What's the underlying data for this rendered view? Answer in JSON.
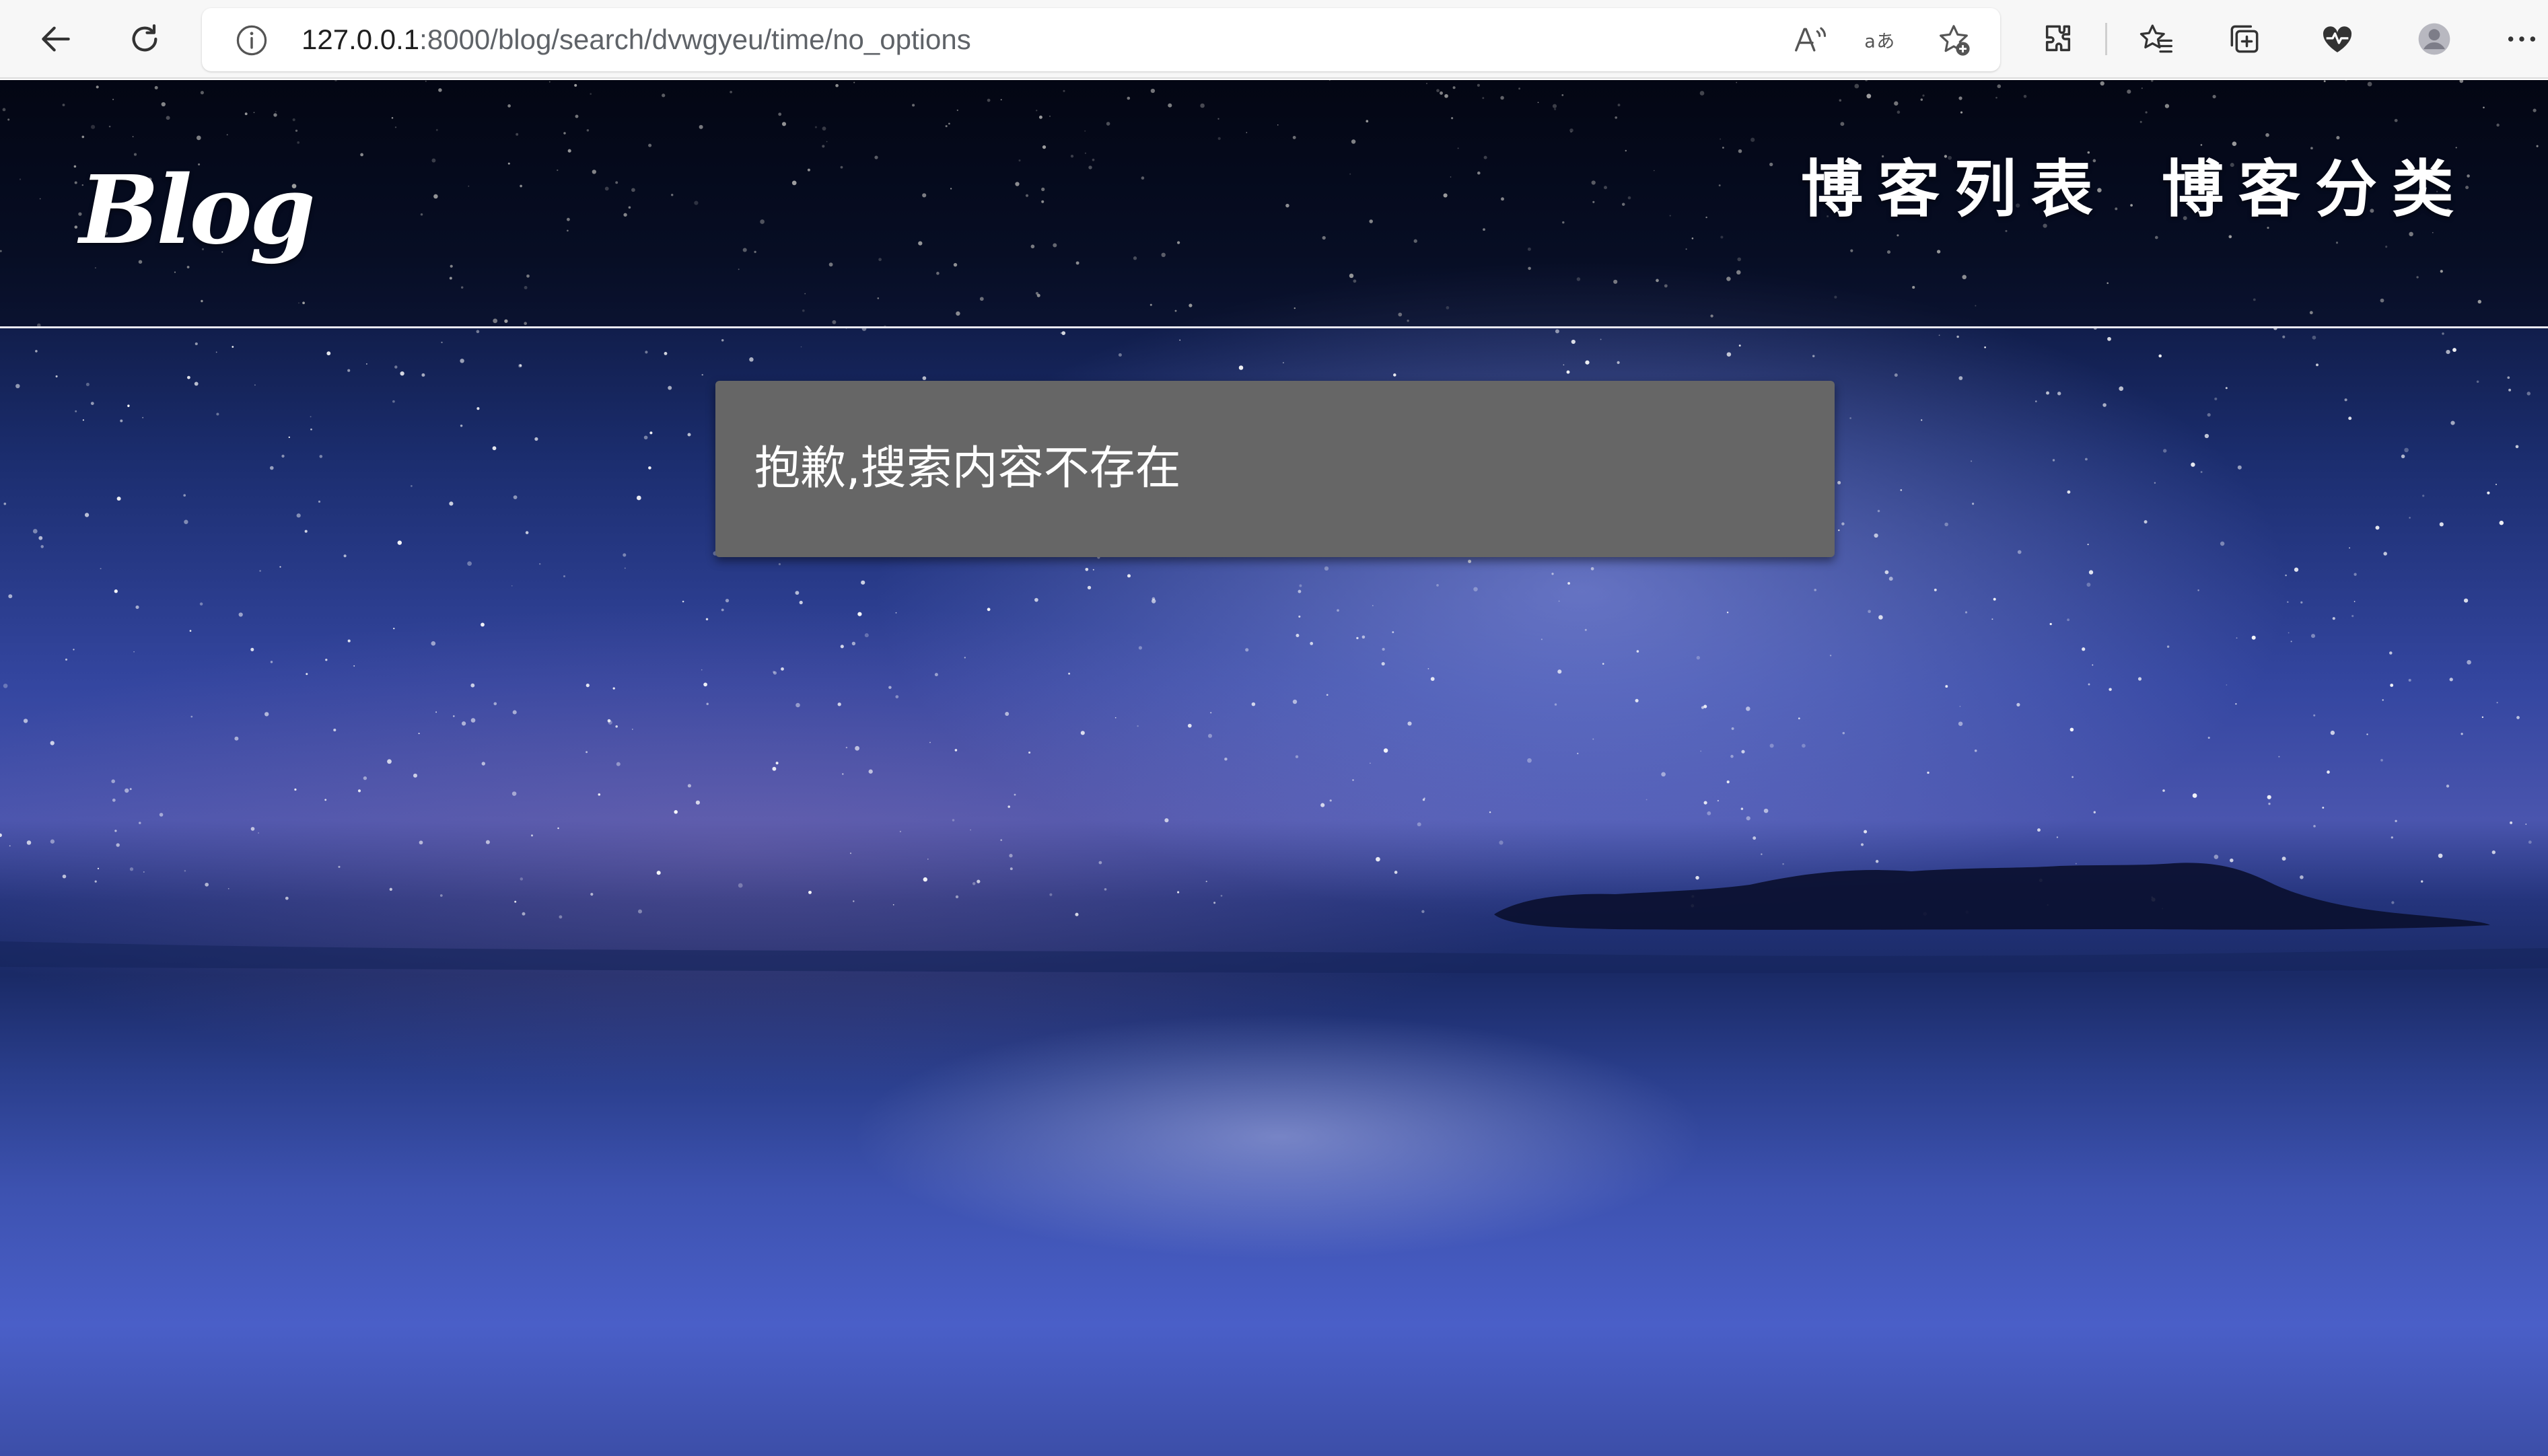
{
  "browser": {
    "address_bar": {
      "url_host": "127.0.0.1",
      "url_rest": ":8000/blog/search/dvwgyeu/time/no_options"
    },
    "toolbar_icons": [
      "back-icon",
      "refresh-icon",
      "info-icon",
      "read-aloud-icon",
      "translate-icon",
      "add-favorite-icon",
      "extensions-icon",
      "favorites-icon",
      "collections-icon",
      "browser-essentials-icon",
      "profile-icon",
      "more-icon"
    ]
  },
  "site": {
    "logo": "Blog",
    "nav": {
      "list_label": "博客列表",
      "category_label": "博客分类"
    }
  },
  "main": {
    "message": "抱歉,搜索内容不存在"
  },
  "colors": {
    "message_box": "#666666",
    "header_text": "#ffffff",
    "sky_top": "#060a1e",
    "sea": "#3d52b0"
  }
}
